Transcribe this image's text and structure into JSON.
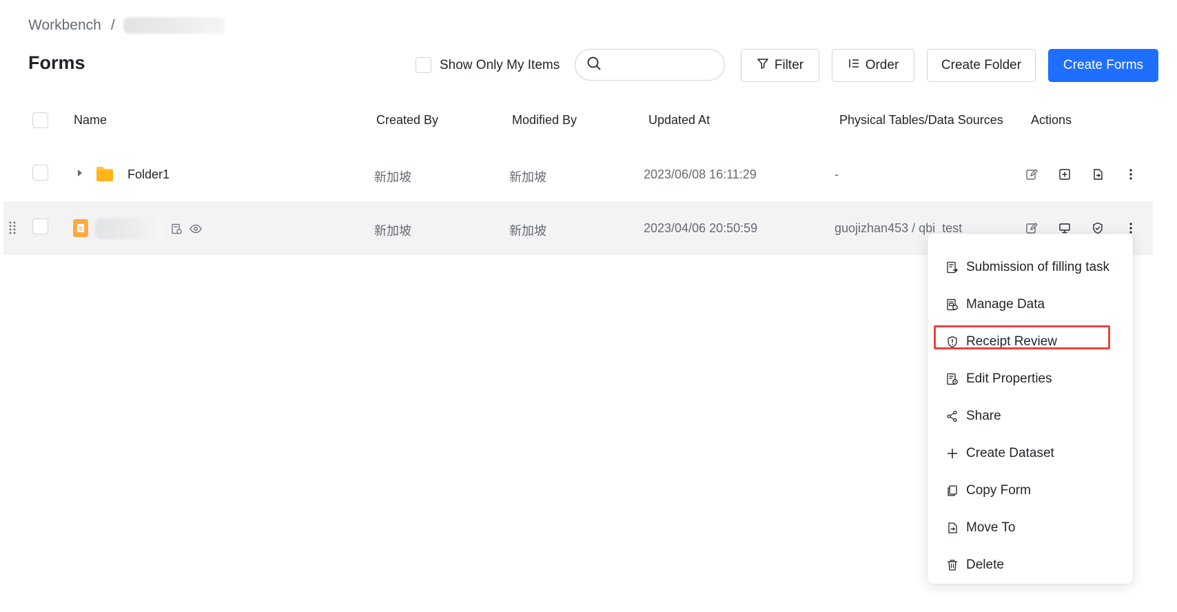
{
  "breadcrumb": {
    "root": "Workbench",
    "separator": "/"
  },
  "page_title": "Forms",
  "toolbar": {
    "show_only_mine_label": "Show Only My Items",
    "search_placeholder": "",
    "filter_label": "Filter",
    "order_label": "Order",
    "create_folder_label": "Create Folder",
    "create_forms_label": "Create Forms"
  },
  "table": {
    "columns": [
      "Name",
      "Created By",
      "Modified By",
      "Updated At",
      "Physical Tables/Data Sources",
      "Actions"
    ],
    "rows": [
      {
        "name": "Folder1",
        "created_by": "新加坡",
        "modified_by": "新加坡",
        "updated_at": "2023/06/08 16:11:29",
        "source": "-"
      },
      {
        "name": "",
        "created_by": "新加坡",
        "modified_by": "新加坡",
        "updated_at": "2023/04/06 20:50:59",
        "source": "guojizhan453 / qbi_test"
      }
    ]
  },
  "menu": {
    "items": [
      {
        "label": "Submission of filling task",
        "icon": "submit-task-icon"
      },
      {
        "label": "Manage Data",
        "icon": "manage-data-icon"
      },
      {
        "label": "Receipt Review",
        "icon": "shield-icon"
      },
      {
        "label": "Edit Properties",
        "icon": "edit-properties-icon"
      },
      {
        "label": "Share",
        "icon": "share-icon"
      },
      {
        "label": "Create Dataset",
        "icon": "plus-icon"
      },
      {
        "label": "Copy Form",
        "icon": "copy-icon"
      },
      {
        "label": "Move To",
        "icon": "move-to-icon"
      },
      {
        "label": "Delete",
        "icon": "trash-icon"
      }
    ]
  },
  "colors": {
    "primary": "#1e6fff",
    "folder": "#ffc53d",
    "form": "#ffa940",
    "highlight": "#e8453c"
  }
}
